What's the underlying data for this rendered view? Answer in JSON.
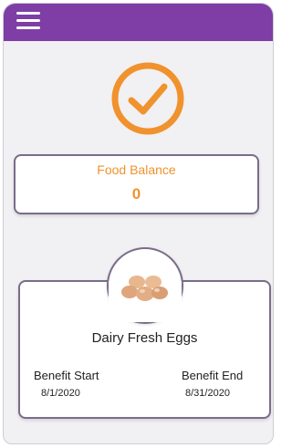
{
  "header": {
    "menu_icon": "hamburger-menu-icon",
    "color": "#7e3ea6"
  },
  "status": {
    "icon": "check-circle-icon",
    "color": "#f0922d"
  },
  "balance": {
    "label": "Food Balance",
    "value": "0"
  },
  "benefit": {
    "image_icon": "eggs-icon",
    "product_name": "Dairy Fresh Eggs",
    "start_label": "Benefit Start",
    "start_date": "8/1/2020",
    "end_label": "Benefit End",
    "end_date": "8/31/2020"
  }
}
